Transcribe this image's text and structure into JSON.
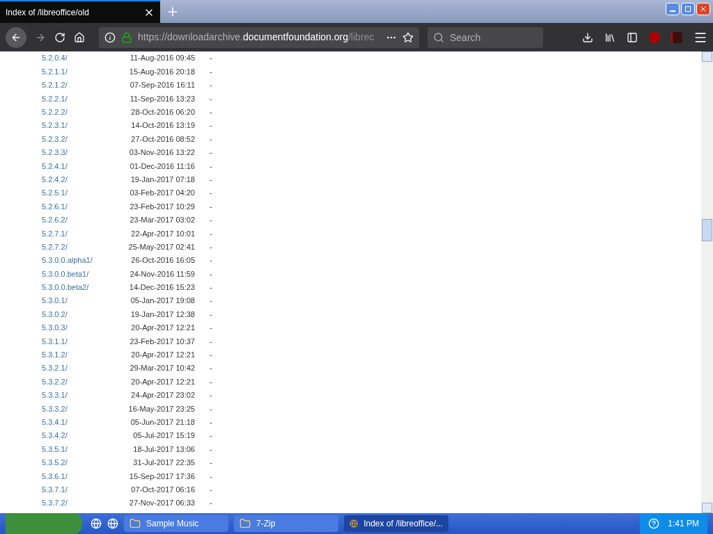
{
  "tab": {
    "title": "Index of /libreoffice/old"
  },
  "address": {
    "prefix": "https://downloadarchive.",
    "domain": "documentfoundation.org",
    "path": "/librec"
  },
  "search": {
    "placeholder": "Search"
  },
  "listing": [
    {
      "name": "5.2.0.4/",
      "modified": "11-Aug-2016 09:45",
      "size": "-"
    },
    {
      "name": "5.2.1.1/",
      "modified": "15-Aug-2016 20:18",
      "size": "-"
    },
    {
      "name": "5.2.1.2/",
      "modified": "07-Sep-2016 16:11",
      "size": "-"
    },
    {
      "name": "5.2.2.1/",
      "modified": "11-Sep-2016 13:23",
      "size": "-"
    },
    {
      "name": "5.2.2.2/",
      "modified": "28-Oct-2016 06:20",
      "size": "-"
    },
    {
      "name": "5.2.3.1/",
      "modified": "14-Oct-2016 13:19",
      "size": "-"
    },
    {
      "name": "5.2.3.2/",
      "modified": "27-Oct-2016 08:52",
      "size": "-"
    },
    {
      "name": "5.2.3.3/",
      "modified": "03-Nov-2016 13:22",
      "size": "-"
    },
    {
      "name": "5.2.4.1/",
      "modified": "01-Dec-2016 11:16",
      "size": "-"
    },
    {
      "name": "5.2.4.2/",
      "modified": "19-Jan-2017 07:18",
      "size": "-"
    },
    {
      "name": "5.2.5.1/",
      "modified": "03-Feb-2017 04:20",
      "size": "-"
    },
    {
      "name": "5.2.6.1/",
      "modified": "23-Feb-2017 10:29",
      "size": "-"
    },
    {
      "name": "5.2.6.2/",
      "modified": "23-Mar-2017 03:02",
      "size": "-"
    },
    {
      "name": "5.2.7.1/",
      "modified": "22-Apr-2017 10:01",
      "size": "-"
    },
    {
      "name": "5.2.7.2/",
      "modified": "25-May-2017 02:41",
      "size": "-"
    },
    {
      "name": "5.3.0.0.alpha1/",
      "modified": "26-Oct-2016 16:05",
      "size": "-"
    },
    {
      "name": "5.3.0.0.beta1/",
      "modified": "24-Nov-2016 11:59",
      "size": "-"
    },
    {
      "name": "5.3.0.0.beta2/",
      "modified": "14-Dec-2016 15:23",
      "size": "-"
    },
    {
      "name": "5.3.0.1/",
      "modified": "05-Jan-2017 19:08",
      "size": "-"
    },
    {
      "name": "5.3.0.2/",
      "modified": "19-Jan-2017 12:38",
      "size": "-"
    },
    {
      "name": "5.3.0.3/",
      "modified": "20-Apr-2017 12:21",
      "size": "-"
    },
    {
      "name": "5.3.1.1/",
      "modified": "23-Feb-2017 10:37",
      "size": "-"
    },
    {
      "name": "5.3.1.2/",
      "modified": "20-Apr-2017 12:21",
      "size": "-"
    },
    {
      "name": "5.3.2.1/",
      "modified": "29-Mar-2017 10:42",
      "size": "-"
    },
    {
      "name": "5.3.2.2/",
      "modified": "20-Apr-2017 12:21",
      "size": "-"
    },
    {
      "name": "5.3.3.1/",
      "modified": "24-Apr-2017 23:02",
      "size": "-"
    },
    {
      "name": "5.3.3.2/",
      "modified": "16-May-2017 23:25",
      "size": "-"
    },
    {
      "name": "5.3.4.1/",
      "modified": "05-Jun-2017 21:18",
      "size": "-"
    },
    {
      "name": "5.3.4.2/",
      "modified": "05-Jul-2017 15:19",
      "size": "-"
    },
    {
      "name": "5.3.5.1/",
      "modified": "18-Jul-2017 13:06",
      "size": "-"
    },
    {
      "name": "5.3.5.2/",
      "modified": "31-Jul-2017 22:35",
      "size": "-"
    },
    {
      "name": "5.3.6.1/",
      "modified": "15-Sep-2017 17:36",
      "size": "-"
    },
    {
      "name": "5.3.7.1/",
      "modified": "07-Oct-2017 06:16",
      "size": "-"
    },
    {
      "name": "5.3.7.2/",
      "modified": "27-Nov-2017 06:33",
      "size": "-"
    }
  ],
  "taskbar": {
    "items": [
      {
        "label": "Sample Music",
        "kind": "folder",
        "selected": false
      },
      {
        "label": "7-Zip",
        "kind": "folder",
        "selected": false
      },
      {
        "label": "Index of /libreoffice/...",
        "kind": "browser",
        "selected": true
      }
    ],
    "clock": "1:41 PM"
  }
}
